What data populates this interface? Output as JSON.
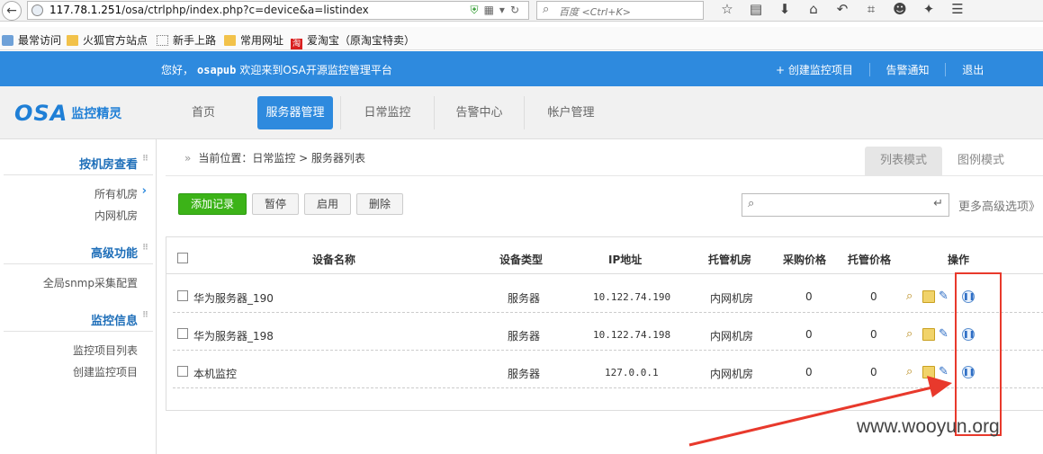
{
  "browser": {
    "url_host": "117.78.1.251",
    "url_path": "/osa/ctrlphp/index.php?c=device&a=listindex",
    "search_placeholder": "百度 <Ctrl+K>",
    "bookmarks": [
      "最常访问",
      "火狐官方站点",
      "新手上路",
      "常用网址",
      "爱淘宝（原淘宝特卖）"
    ]
  },
  "topbar": {
    "greeting_prefix": "您好，",
    "username": "osapub",
    "greeting_suffix": "欢迎来到OSA开源监控管理平台",
    "links": [
      "+ 创建监控项目",
      "告警通知",
      "退出"
    ]
  },
  "logo": {
    "brand": "OSA",
    "subtitle": "监控精灵"
  },
  "nav": {
    "items": [
      "首页",
      "服务器管理",
      "日常监控",
      "告警中心",
      "帐户管理"
    ],
    "active": "服务器管理"
  },
  "sidebar": {
    "sections": [
      {
        "title": "按机房查看",
        "items": [
          "所有机房",
          "内网机房"
        ]
      },
      {
        "title": "高级功能",
        "items": [
          "全局snmp采集配置"
        ]
      },
      {
        "title": "监控信息",
        "items": [
          "监控项目列表",
          "创建监控项目"
        ]
      }
    ]
  },
  "breadcrumb": {
    "prefix": "»",
    "label": "当前位置：日常监控 > 服务器列表"
  },
  "view_tabs": [
    "列表模式",
    "图例模式"
  ],
  "actions": {
    "add": "添加记录",
    "pause": "暂停",
    "enable": "启用",
    "delete": "删除"
  },
  "filter": {
    "more": "更多高级选项》"
  },
  "table": {
    "headers": [
      "设备名称",
      "设备类型",
      "IP地址",
      "托管机房",
      "采购价格",
      "托管价格",
      "操作"
    ],
    "rows": [
      {
        "name": "华为服务器_190",
        "type": "服务器",
        "ip": "10.122.74.190",
        "room": "内网机房",
        "buy": "0",
        "host": "0"
      },
      {
        "name": "华为服务器_198",
        "type": "服务器",
        "ip": "10.122.74.198",
        "room": "内网机房",
        "buy": "0",
        "host": "0"
      },
      {
        "name": "本机监控",
        "type": "服务器",
        "ip": "127.0.0.1",
        "room": "内网机房",
        "buy": "0",
        "host": "0"
      }
    ]
  },
  "watermark": "www.wooyun.org",
  "colors": {
    "primary": "#2e8ade",
    "add_button": "#3cb318",
    "annotation": "#e8392c"
  }
}
